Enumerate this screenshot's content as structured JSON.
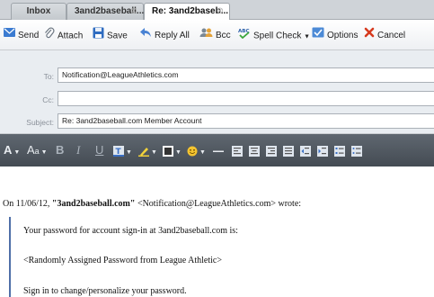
{
  "tabs": [
    {
      "label": "Inbox"
    },
    {
      "label": "3and2baseball...."
    },
    {
      "label": "Re: 3and2baseb...",
      "active": true
    }
  ],
  "toolbar": {
    "send": "Send",
    "attach": "Attach",
    "save": "Save",
    "reply_all": "Reply All",
    "bcc": "Bcc",
    "spell_check": "Spell Check",
    "options": "Options",
    "cancel": "Cancel"
  },
  "fields": {
    "to_label": "To:",
    "to_value": "Notification@LeagueAthletics.com",
    "cc_label": "Cc:",
    "cc_value": "",
    "subject_label": "Subject:",
    "subject_value": "Re: 3and2baseball.com Member Account"
  },
  "body": {
    "wrote_prefix": "On 11/06/12, ",
    "wrote_name": "\"3and2baseball.com\"",
    "wrote_suffix": " <Notification@LeagueAthletics.com> wrote:",
    "quote_lines": [
      "Your password for account sign-in at 3and2baseball.com is:",
      "<Randomly Assigned Password from League Athletic>",
      "Sign in to change/personalize your password."
    ]
  },
  "colors": {
    "format_bar": "#4a5159",
    "fields_bg": "#e9edf1",
    "quote_bar": "#4f6fa8",
    "cancel_red": "#d63a1e"
  }
}
